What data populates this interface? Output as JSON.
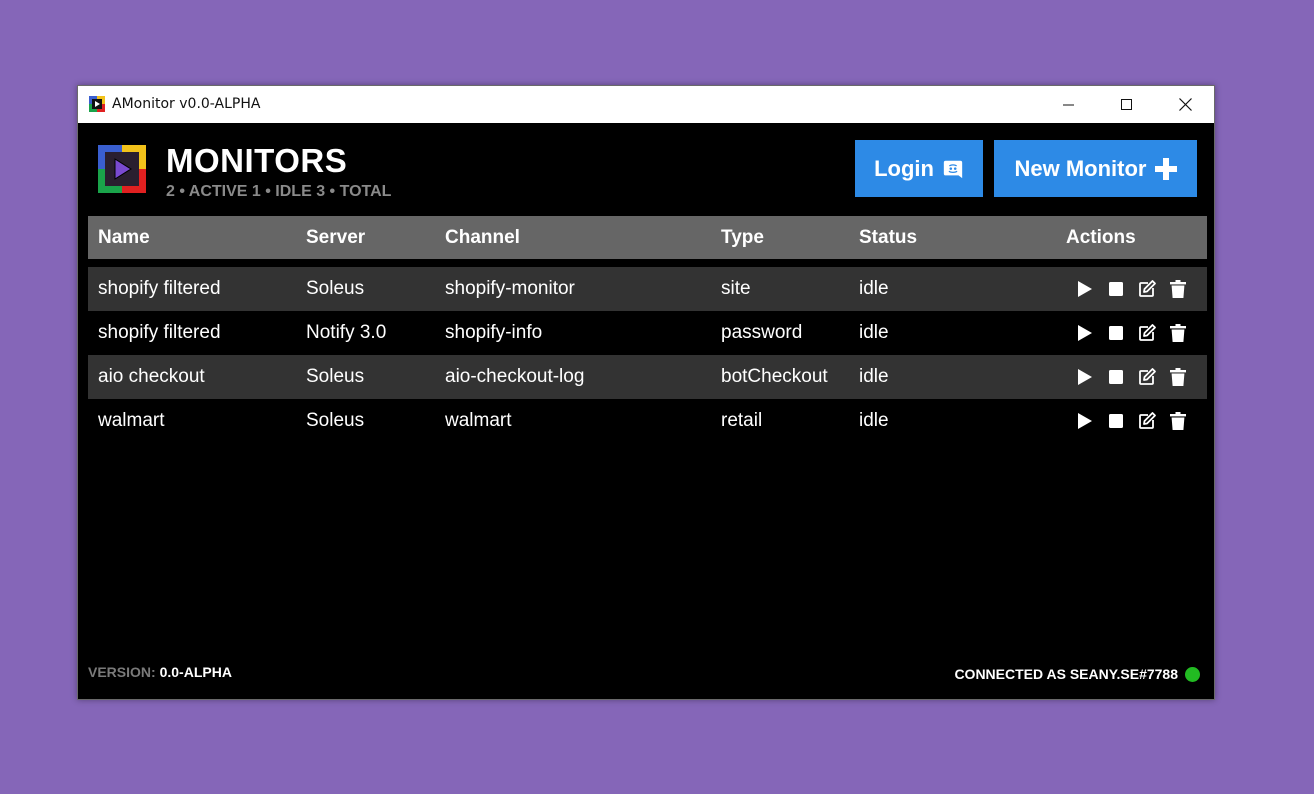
{
  "window": {
    "title": "AMonitor v0.0-ALPHA"
  },
  "header": {
    "title": "MONITORS",
    "stats": "2 • ACTIVE 1 • IDLE 3 • TOTAL",
    "login_label": "Login",
    "new_monitor_label": "New Monitor"
  },
  "table": {
    "columns": [
      "Name",
      "Server",
      "Channel",
      "Type",
      "Status",
      "Actions"
    ],
    "rows": [
      {
        "name": "shopify filtered",
        "server": "Soleus",
        "channel": "shopify-monitor",
        "type": "site",
        "status": "idle"
      },
      {
        "name": "shopify filtered",
        "server": "Notify 3.0",
        "channel": "shopify-info",
        "type": "password",
        "status": "idle"
      },
      {
        "name": "aio checkout",
        "server": "Soleus",
        "channel": "aio-checkout-log",
        "type": "botCheckout",
        "status": "idle"
      },
      {
        "name": "walmart",
        "server": "Soleus",
        "channel": "walmart",
        "type": "retail",
        "status": "idle"
      }
    ],
    "row_actions": [
      "play-icon",
      "stop-icon",
      "edit-icon",
      "trash-icon"
    ]
  },
  "footer": {
    "version_label": "VERSION:",
    "version_value": "0.0-ALPHA",
    "connection": "CONNECTED AS SEANY.SE#7788"
  },
  "colors": {
    "accent": "#2d8ae6",
    "header_row": "#666666",
    "alt_row": "#333333",
    "connected": "#22bb22",
    "desktop": "#8566b8"
  },
  "icons": {
    "app": "app-logo-icon",
    "login": "discord-icon",
    "new_monitor": "plus-icon"
  }
}
